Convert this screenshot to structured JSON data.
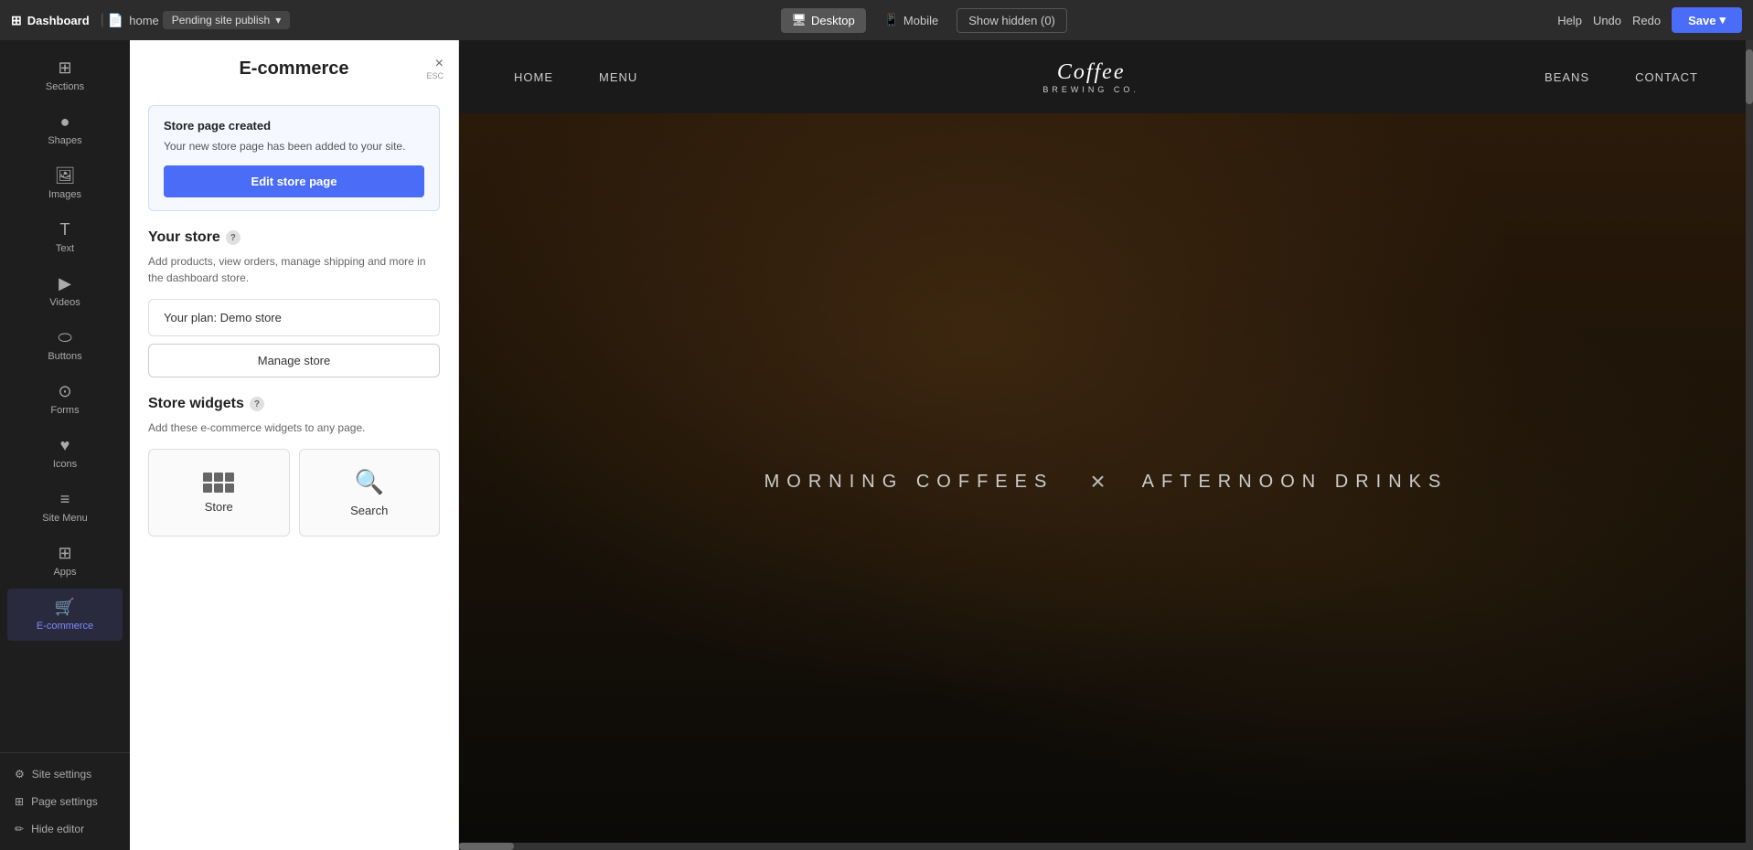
{
  "topbar": {
    "brand": "Dashboard",
    "sep": "|",
    "page_icon": "📄",
    "page_name": "home",
    "pending_label": "Pending site publish",
    "chevron": "▾",
    "device_desktop": "Desktop",
    "device_mobile": "Mobile",
    "show_hidden": "Show hidden (0)",
    "help": "Help",
    "undo": "Undo",
    "redo": "Redo",
    "save": "Save",
    "save_chevron": "▾"
  },
  "sidebar": {
    "items": [
      {
        "id": "sections",
        "label": "Sections",
        "icon": "⊞"
      },
      {
        "id": "shapes",
        "label": "Shapes",
        "icon": "●"
      },
      {
        "id": "images",
        "label": "Images",
        "icon": "🖼"
      },
      {
        "id": "text",
        "label": "Text",
        "icon": "T"
      },
      {
        "id": "videos",
        "label": "Videos",
        "icon": "▶"
      },
      {
        "id": "buttons",
        "label": "Buttons",
        "icon": "⬭"
      },
      {
        "id": "forms",
        "label": "Forms",
        "icon": "⊙"
      },
      {
        "id": "icons",
        "label": "Icons",
        "icon": "♥"
      },
      {
        "id": "site-menu",
        "label": "Site Menu",
        "icon": "≡"
      },
      {
        "id": "apps",
        "label": "Apps",
        "icon": "⊞"
      },
      {
        "id": "e-commerce",
        "label": "E-commerce",
        "icon": "🛒",
        "active": true
      }
    ],
    "bottom": [
      {
        "id": "site-settings",
        "label": "Site settings",
        "icon": "⚙"
      },
      {
        "id": "page-settings",
        "label": "Page settings",
        "icon": "⊞"
      },
      {
        "id": "hide-editor",
        "label": "Hide editor",
        "icon": "✏"
      }
    ]
  },
  "panel": {
    "title": "E-commerce",
    "close_label": "×",
    "esc_label": "ESC",
    "info_box": {
      "title": "Store page created",
      "text": "Your new store page has been added to your site.",
      "edit_btn": "Edit store page"
    },
    "your_store": {
      "title": "Your store",
      "help": "?",
      "desc": "Add products, view orders, manage shipping and more in the dashboard store.",
      "plan_label": "Your plan: Demo store",
      "manage_btn": "Manage store"
    },
    "widgets": {
      "title": "Store widgets",
      "help": "?",
      "desc": "Add these e-commerce widgets to any page.",
      "items": [
        {
          "id": "store",
          "label": "Store"
        },
        {
          "id": "search",
          "label": "Search"
        }
      ]
    }
  },
  "preview": {
    "nav": {
      "links_left": [
        "HOME",
        "MENU"
      ],
      "logo_text": "Coffee",
      "logo_sub": "BREWING CO.",
      "links_right": [
        "BEANS",
        "CONTACT"
      ]
    },
    "hero": {
      "text_left": "MORNING COFFEES",
      "sep": "×",
      "text_right": "AFTERNOON DRINKS"
    }
  }
}
